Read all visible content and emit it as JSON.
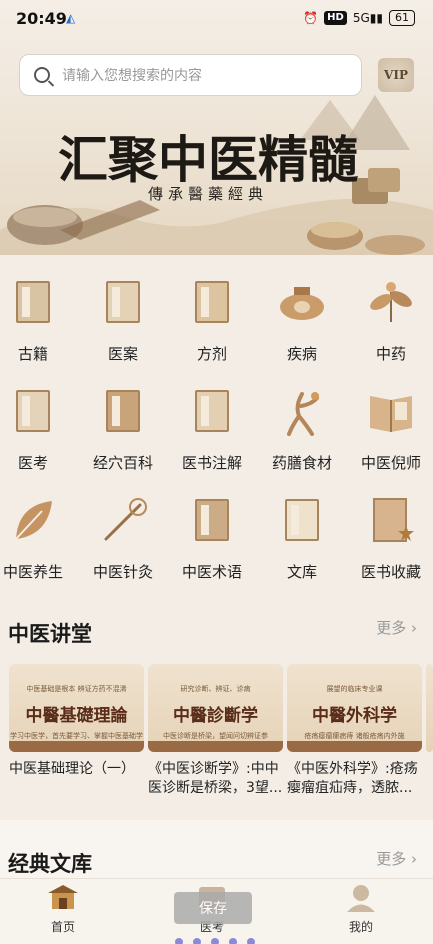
{
  "status": {
    "time": "20:49",
    "hd": "HD",
    "signal": "5G",
    "battery": "61"
  },
  "search": {
    "placeholder": "请输入您想搜索的内容",
    "vip_label": "VIP"
  },
  "banner": {
    "title": "汇聚中医精髓",
    "subtitle": "傳承醫藥經典"
  },
  "categories": [
    {
      "label": "古籍",
      "icon": "ancient-book-icon"
    },
    {
      "label": "医案",
      "icon": "case-file-icon"
    },
    {
      "label": "方剂",
      "icon": "prescription-icon"
    },
    {
      "label": "疾病",
      "icon": "disease-pot-icon"
    },
    {
      "label": "中药",
      "icon": "herb-icon"
    },
    {
      "label": "医考",
      "icon": "exam-icon"
    },
    {
      "label": "经穴百科",
      "icon": "acupoint-book-icon"
    },
    {
      "label": "医书注解",
      "icon": "annotation-icon"
    },
    {
      "label": "药膳食材",
      "icon": "ginseng-icon"
    },
    {
      "label": "中医倪师",
      "icon": "master-book-icon"
    },
    {
      "label": "中医养生",
      "icon": "leaf-icon"
    },
    {
      "label": "中医针灸",
      "icon": "needle-icon"
    },
    {
      "label": "中医术语",
      "icon": "term-book-icon"
    },
    {
      "label": "文库",
      "icon": "library-icon"
    },
    {
      "label": "医书收藏",
      "icon": "bookmark-star-icon"
    }
  ],
  "lecture": {
    "title": "中医讲堂",
    "more": "更多",
    "courses": [
      {
        "name": "中醫基礎理論",
        "top": "中医基础是根本 辨证方药不混淆",
        "sub": "学习中医学，首先要学习、掌握中医基础学",
        "caption": "中医基础理论（一）"
      },
      {
        "name": "中醫診斷学",
        "top": "研究诊断、辨证、诊病",
        "sub": "中医诊断是桥梁，望闻问切辨证参",
        "caption": "《中医诊断学》:中中医诊断是桥梁，3望..."
      },
      {
        "name": "中醫外科学",
        "top": "展望的临床专业课",
        "sub": "疮疡瘿瘤瘰疬痔 诸般疮疡内外施",
        "caption": "《中医外科学》:疮疡瘿瘤疽疝痔，透脓..."
      }
    ]
  },
  "library": {
    "title": "经典文库",
    "more": "更多"
  },
  "tabs": [
    {
      "label": "首页",
      "icon": "home-pavilion-icon"
    },
    {
      "label": "医考",
      "icon": "exam-tab-icon"
    },
    {
      "label": "我的",
      "icon": "profile-icon"
    }
  ],
  "toast": "保存"
}
